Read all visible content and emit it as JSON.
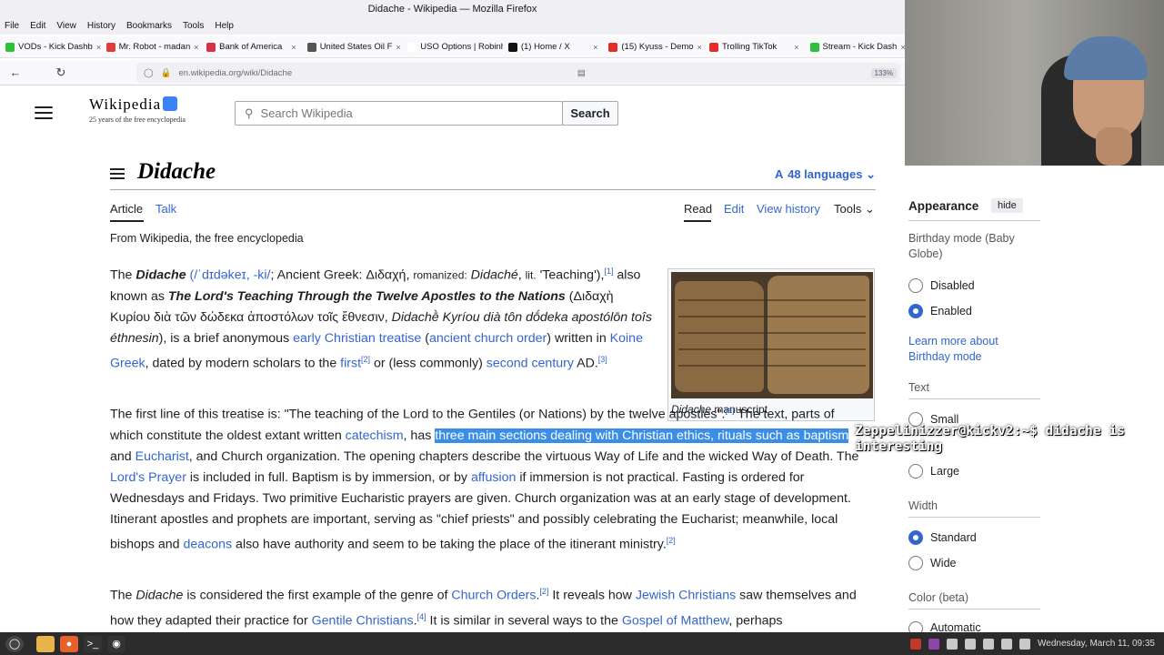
{
  "window": {
    "title": "Didache - Wikipedia — Mozilla Firefox"
  },
  "menu": [
    "File",
    "Edit",
    "View",
    "History",
    "Bookmarks",
    "Tools",
    "Help"
  ],
  "bookmarks": [
    {
      "label": "VODs - Kick Dashb",
      "color": "#2fbf3a"
    },
    {
      "label": "Mr. Robot - madan",
      "color": "#e23b3b"
    },
    {
      "label": "Bank of America",
      "color": "#d6304a"
    },
    {
      "label": "United States Oil F",
      "color": "#555555"
    },
    {
      "label": "USO Options | Robinh",
      "color": "#ffffff"
    },
    {
      "label": "(1) Home / X",
      "color": "#111111"
    },
    {
      "label": "(15) Kyuss - Demo",
      "color": "#e52d27"
    },
    {
      "label": "Trolling TikTok",
      "color": "#e52d27"
    },
    {
      "label": "Stream - Kick Dash",
      "color": "#2fbf3a"
    }
  ],
  "address": {
    "url": "en.wikipedia.org/wiki/Didache",
    "zoom": "133%"
  },
  "wiki": {
    "logo_word": "Wikipedia",
    "logo_tag": "25 years of the free encyclopedia",
    "search_placeholder": "Search Wikipedia",
    "search_button": "Search",
    "title": "Didache",
    "languages": "48 languages",
    "tabs": {
      "article": "Article",
      "talk": "Talk",
      "read": "Read",
      "edit": "Edit",
      "history": "View history",
      "tools": "Tools"
    },
    "from": "From Wikipedia, the free encyclopedia",
    "caption_italic": "Didache",
    "caption_rest": " manuscript"
  },
  "appearance": {
    "title": "Appearance",
    "hide": "hide",
    "birthday_label": "Birthday mode (Baby Globe)",
    "disabled": "Disabled",
    "enabled": "Enabled",
    "learn_more": "Learn more about Birthday mode",
    "text_label": "Text",
    "small": "Small",
    "large": "Large",
    "width_label": "Width",
    "standard": "Standard",
    "wide": "Wide",
    "color_label": "Color (beta)",
    "automatic": "Automatic"
  },
  "chat_overlay": {
    "user": "Zeppelinizzer@kickv2:~$",
    "message": "didache is interesting"
  },
  "taskbar": {
    "datetime": "Wednesday, March 11, 09:35"
  }
}
